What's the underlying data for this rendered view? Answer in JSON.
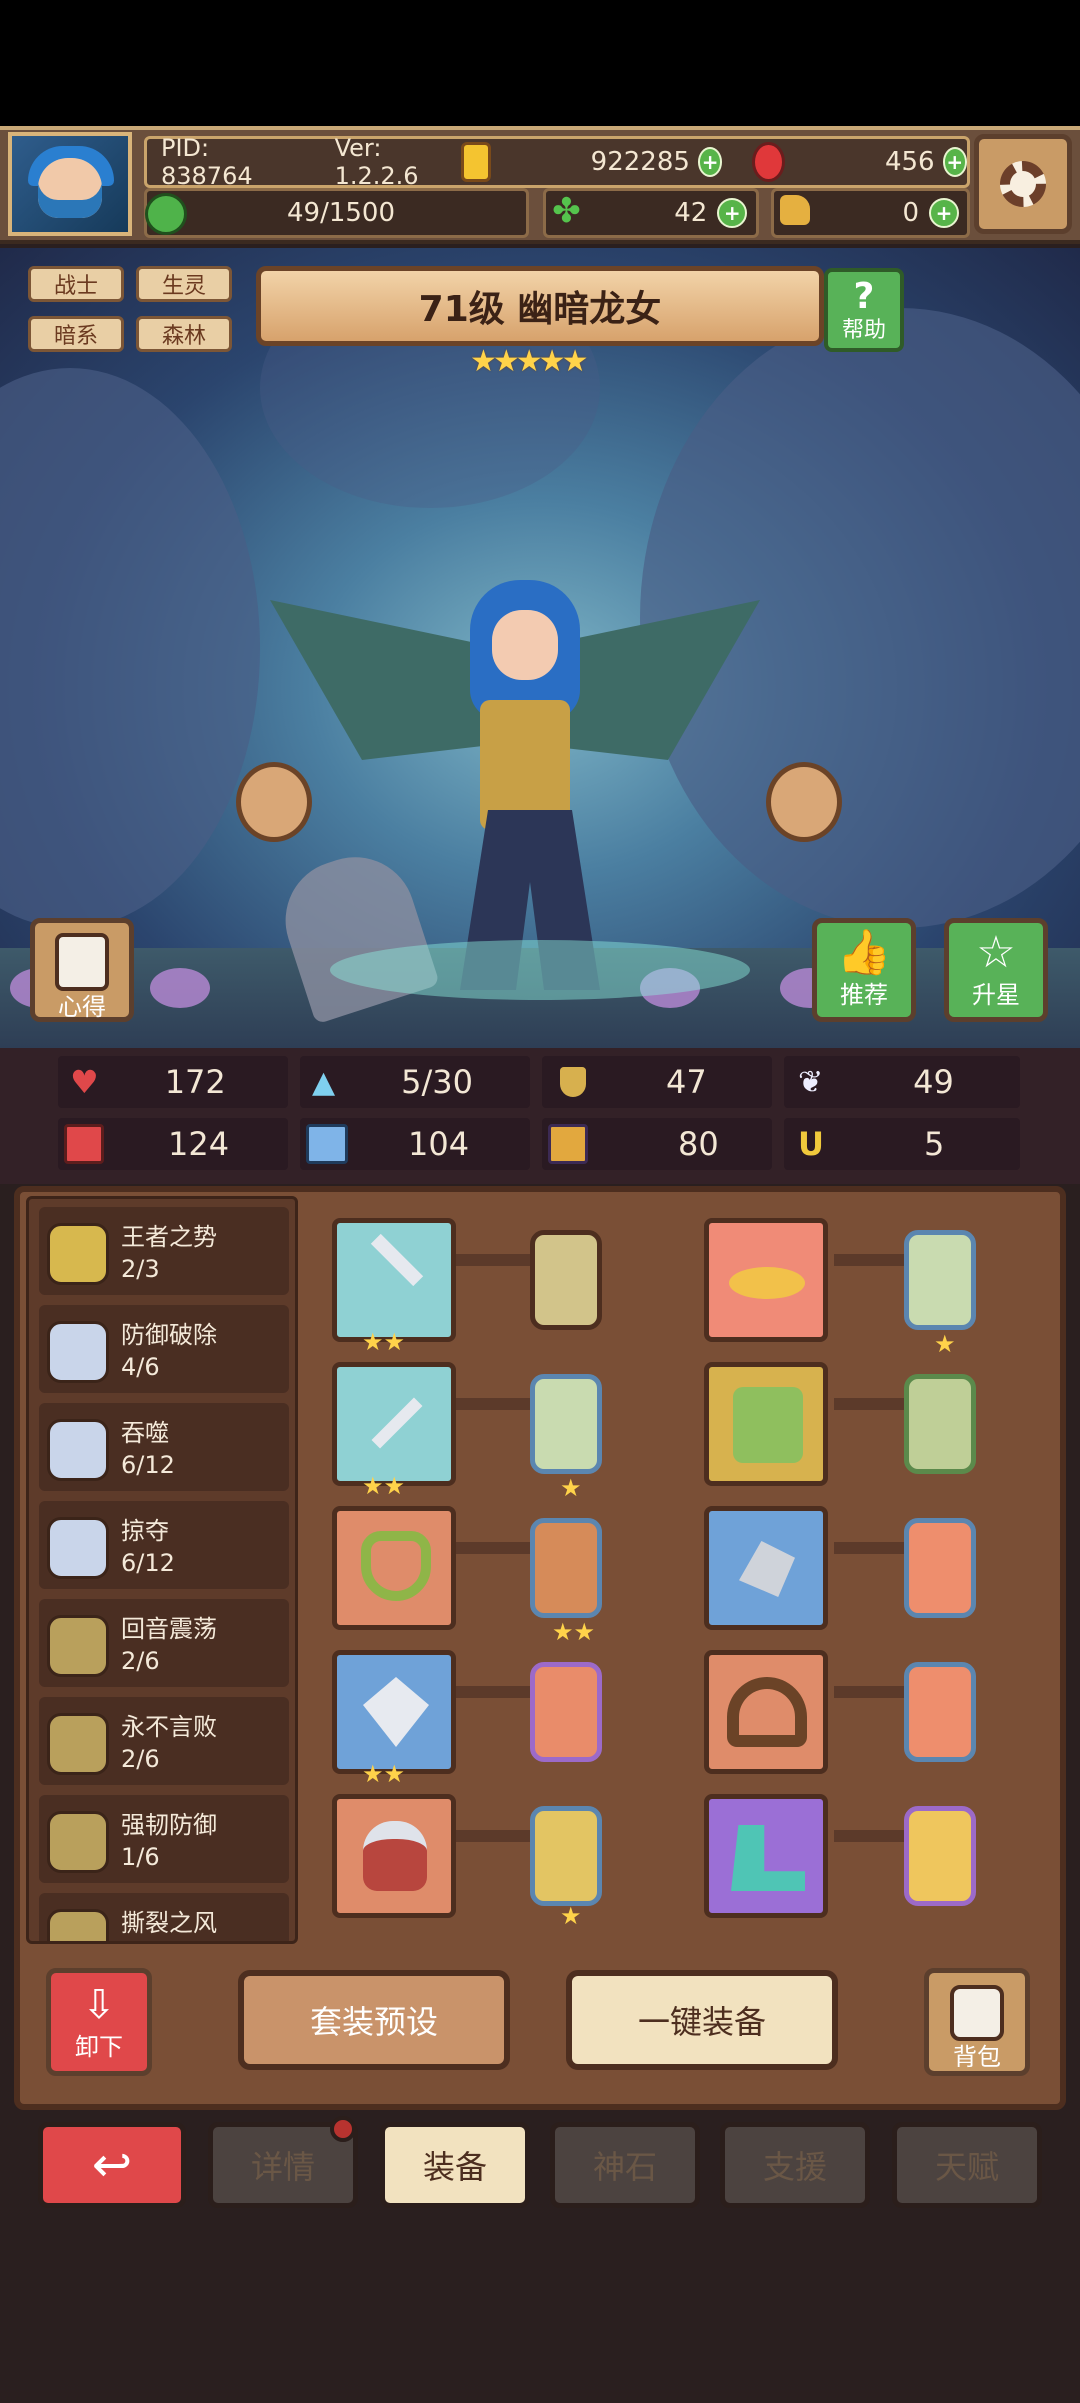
{
  "header": {
    "pid": "PID: 838764",
    "version": "Ver: 1.2.2.6",
    "gold": "922285",
    "gems": "456",
    "stamina": "49/1500",
    "clover": "42",
    "hand": "0"
  },
  "hero": {
    "tags": [
      "战士",
      "生灵",
      "暗系",
      "森林"
    ],
    "title": "71级 幽暗龙女",
    "stars": "★★★★★",
    "help_label": "帮助",
    "left_button": "心得",
    "recommend_label": "推荐",
    "upstar_label": "升星"
  },
  "stats": [
    {
      "icon": "heart-icon",
      "value": "172"
    },
    {
      "icon": "water-drop-icon",
      "value": "5/30"
    },
    {
      "icon": "shield-icon",
      "value": "47"
    },
    {
      "icon": "wing-icon",
      "value": "49"
    },
    {
      "icon": "fist-icon",
      "value": "124"
    },
    {
      "icon": "book-icon",
      "value": "104"
    },
    {
      "icon": "boot-icon",
      "value": "80"
    },
    {
      "icon": "horseshoe-icon",
      "value": "5"
    }
  ],
  "sets": [
    {
      "name": "王者之势",
      "count": "2/3"
    },
    {
      "name": "防御破除",
      "count": "4/6"
    },
    {
      "name": "吞噬",
      "count": "6/12"
    },
    {
      "name": "掠夺",
      "count": "6/12"
    },
    {
      "name": "回音震荡",
      "count": "2/6"
    },
    {
      "name": "永不言败",
      "count": "2/6"
    },
    {
      "name": "强韧防御",
      "count": "1/6"
    },
    {
      "name": "撕裂之风",
      "count": ""
    }
  ],
  "equipment": [
    {
      "slot": "sword",
      "stars": "★★",
      "gem_stars": ""
    },
    {
      "slot": "hat",
      "stars": "",
      "gem_stars": "★"
    },
    {
      "slot": "dagger",
      "stars": "★★",
      "gem_stars": "★"
    },
    {
      "slot": "armor",
      "stars": "",
      "gem_stars": ""
    },
    {
      "slot": "necklace",
      "stars": "",
      "gem_stars": "★★"
    },
    {
      "slot": "gauntlet",
      "stars": "",
      "gem_stars": ""
    },
    {
      "slot": "shield",
      "stars": "★★",
      "gem_stars": ""
    },
    {
      "slot": "belt",
      "stars": "",
      "gem_stars": ""
    },
    {
      "slot": "helmet",
      "stars": "",
      "gem_stars": "★"
    },
    {
      "slot": "boots",
      "stars": "",
      "gem_stars": ""
    }
  ],
  "actions": {
    "unequip": "卸下",
    "preset": "套装预设",
    "auto_equip": "一键装备",
    "bag": "背包"
  },
  "nav": {
    "back": "↩",
    "tabs": [
      "详情",
      "装备",
      "神石",
      "支援",
      "天赋"
    ]
  },
  "colors": {
    "accent_red": "#e0484a",
    "accent_green": "#57b449",
    "panel_brown": "#7a4f36"
  }
}
